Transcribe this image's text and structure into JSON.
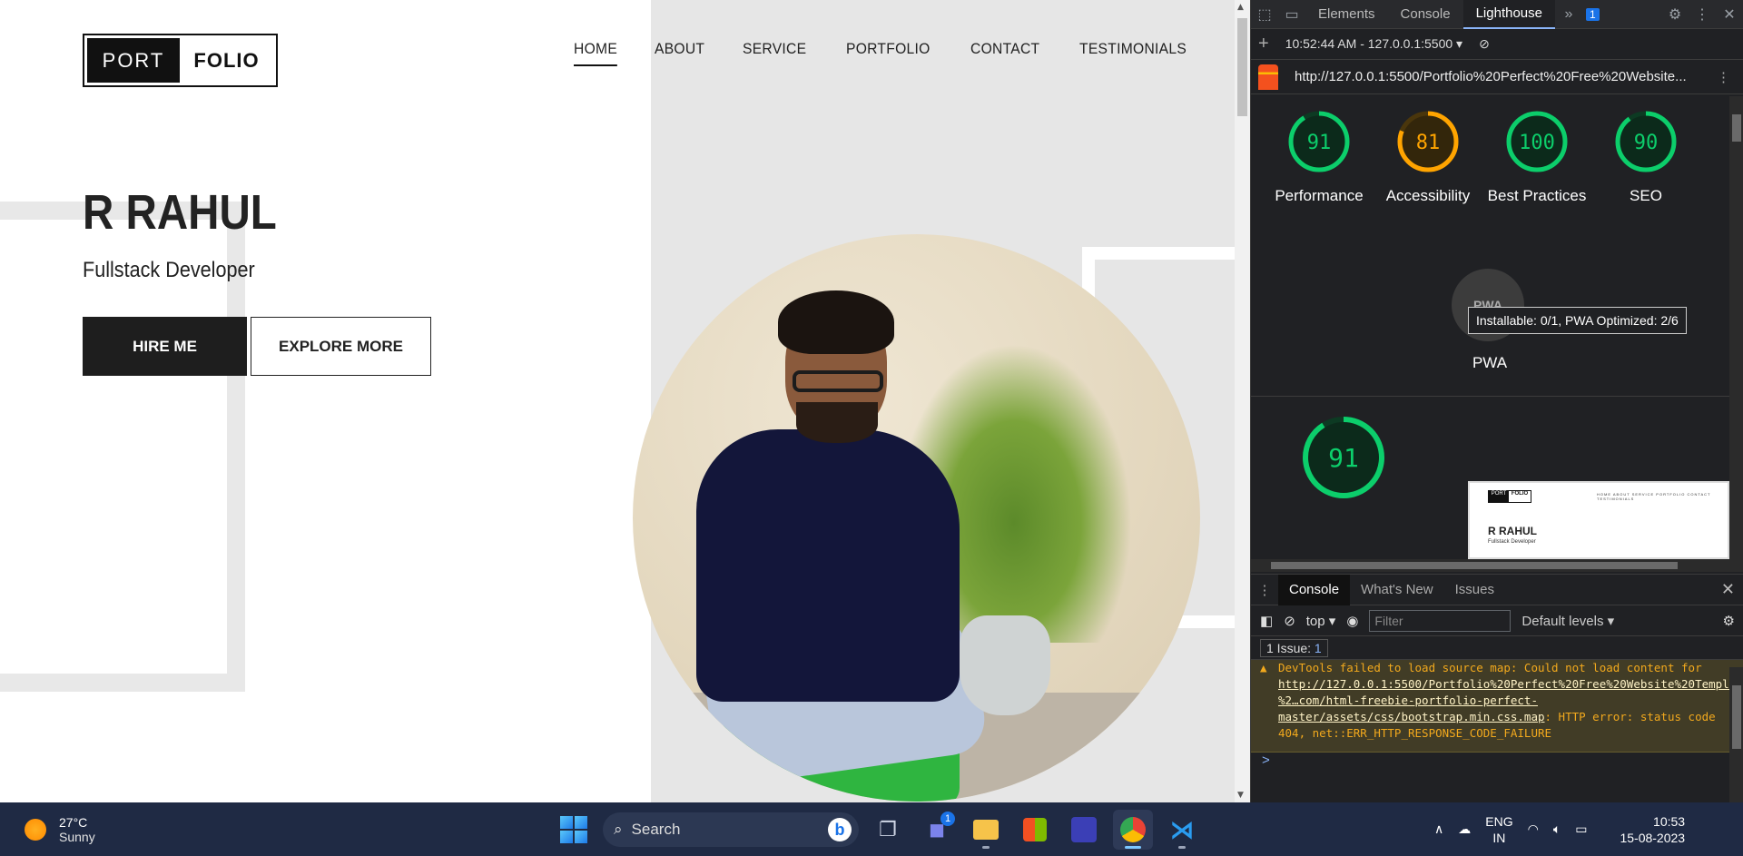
{
  "site": {
    "logo": {
      "left": "PORT",
      "right": "FOLIO"
    },
    "nav": [
      "HOME",
      "ABOUT",
      "SERVICE",
      "PORTFOLIO",
      "CONTACT",
      "TESTIMONIALS"
    ],
    "hero": {
      "name": "R RAHUL",
      "role": "Fullstack Developer",
      "primary_button": "HIRE ME",
      "secondary_button": "EXPLORE MORE"
    }
  },
  "devtools": {
    "tabs": [
      "Elements",
      "Console",
      "Lighthouse"
    ],
    "active_tab": "Lighthouse",
    "issues_badge": "1",
    "report_time": "10:52:44 AM - 127.0.0.1:5500",
    "report_url": "http://127.0.0.1:5500/Portfolio%20Perfect%20Free%20Website...",
    "scores": [
      {
        "label": "Performance",
        "value": 91,
        "color": "#0cce6b"
      },
      {
        "label": "Accessibility",
        "value": 81,
        "color": "#ffa400"
      },
      {
        "label": "Best Practices",
        "value": 100,
        "color": "#0cce6b"
      },
      {
        "label": "SEO",
        "value": 90,
        "color": "#0cce6b"
      }
    ],
    "pwa": {
      "badge": "PWA",
      "label": "PWA",
      "tooltip": "Installable: 0/1, PWA Optimized: 2/6"
    },
    "performance_big": {
      "value": 91,
      "color": "#0cce6b"
    },
    "thumbnail": {
      "logo_left": "PORT",
      "logo_right": "FOLIO",
      "name": "R RAHUL",
      "role": "Fullstack Developer",
      "nav": "HOME  ABOUT  SERVICE  PORTFOLIO  CONTACT  TESTIMONIALS"
    },
    "drawer": {
      "tabs": [
        "Console",
        "What's New",
        "Issues"
      ],
      "context": "top",
      "filter_placeholder": "Filter",
      "levels": "Default levels",
      "issues_label": "1 Issue:",
      "issues_count": "1",
      "warning_prefix": "DevTools failed to load source map: Could not load content for ",
      "warning_link": "http://127.0.0.1:5500/Portfolio%20Perfect%20Free%20Website%20Template%20-%2…com/html-freebie-portfolio-perfect-master/assets/css/bootstrap.min.css.map",
      "warning_suffix": ": HTTP error: status code 404, net::ERR_HTTP_RESPONSE_CODE_FAILURE",
      "prompt": ">"
    }
  },
  "taskbar": {
    "weather": {
      "temp": "27°C",
      "condition": "Sunny"
    },
    "search_placeholder": "Search",
    "chat_badge": "1",
    "language": {
      "line1": "ENG",
      "line2": "IN"
    },
    "time": "10:53",
    "date": "15-08-2023"
  }
}
